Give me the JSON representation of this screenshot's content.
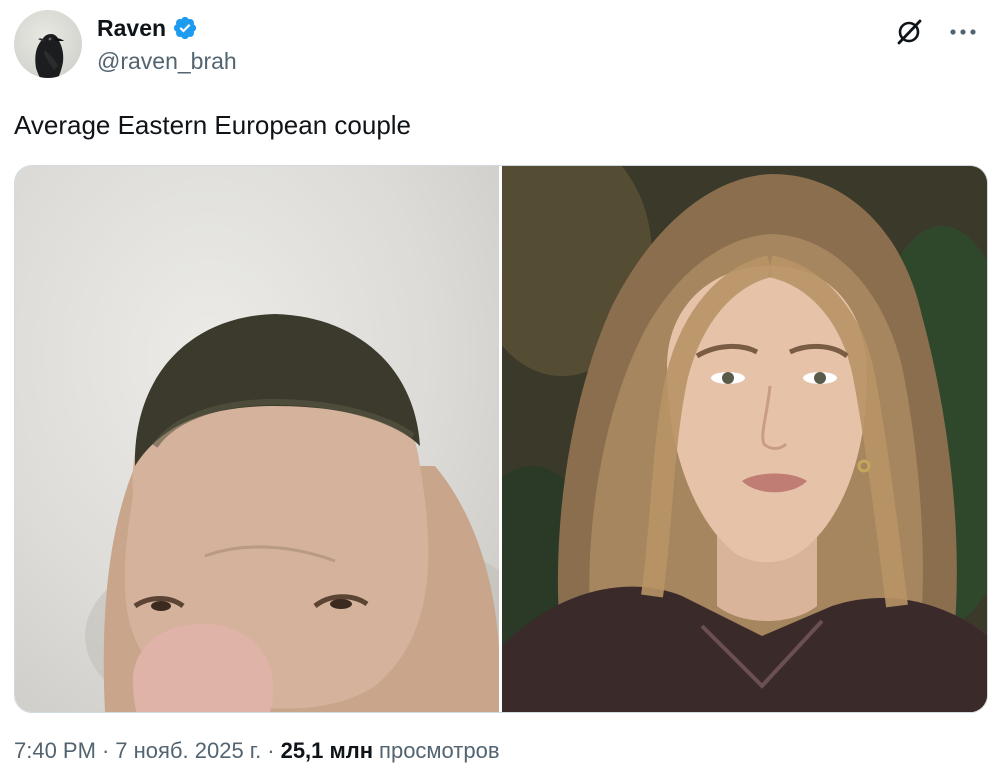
{
  "author": {
    "display_name": "Raven",
    "handle": "@raven_brah",
    "verified": true,
    "avatar": "raven-bird-avatar"
  },
  "header_actions": {
    "grok_icon": "grok-slash-icon",
    "more_icon": "more-dots-icon"
  },
  "tweet": {
    "text": "Average Eastern European couple"
  },
  "media": {
    "images": [
      {
        "subject": "pig-with-buzzcut-photo"
      },
      {
        "subject": "blonde-woman-portrait-photo"
      }
    ]
  },
  "meta": {
    "time": "7:40 PM",
    "separator": "·",
    "date": "7 нояб. 2025 г.",
    "views_count": "25,1 млн",
    "views_label": "просмотров"
  },
  "colors": {
    "verified_badge": "#1d9bf0",
    "text_primary": "#0f1419",
    "text_secondary": "#536471",
    "border": "#cfd9de"
  }
}
